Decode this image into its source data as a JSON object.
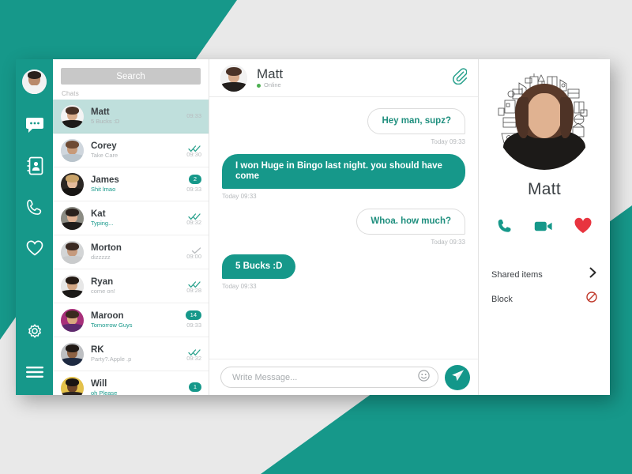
{
  "theme": {
    "accent": "#16988a",
    "accent_dark": "#13978a",
    "selected_row_bg": "#bfdfdc",
    "page_bg": "#e9e9e9",
    "heart_red": "#e8343f",
    "block_red": "#c0392b",
    "online_green": "#4caf50"
  },
  "rail": {
    "avatar_name": "user-avatar",
    "items": [
      {
        "icon": "chat-bubble-icon",
        "label": "Chats"
      },
      {
        "icon": "contacts-book-icon",
        "label": "Contacts"
      },
      {
        "icon": "phone-icon",
        "label": "Calls"
      },
      {
        "icon": "heart-icon",
        "label": "Favorites"
      }
    ],
    "bottom_items": [
      {
        "icon": "gear-icon",
        "label": "Settings"
      },
      {
        "icon": "hamburger-menu-icon",
        "label": "Menu"
      }
    ]
  },
  "sidebar": {
    "search": {
      "placeholder": "Search",
      "value": ""
    },
    "section_label": "Chats",
    "chats": [
      {
        "name": "Matt",
        "preview": "5 Bucks :D",
        "time": "09:33",
        "badge": "",
        "ticks": "none",
        "selected": true,
        "preview_accent": false,
        "avatar": "matt"
      },
      {
        "name": "Corey",
        "preview": "Take Care",
        "time": "09:30",
        "badge": "",
        "ticks": "double",
        "selected": false,
        "preview_accent": false,
        "avatar": "corey"
      },
      {
        "name": "James",
        "preview": "Shit lmao",
        "time": "09:33",
        "badge": "2",
        "ticks": "none",
        "selected": false,
        "preview_accent": true,
        "avatar": "james"
      },
      {
        "name": "Kat",
        "preview": "Typing...",
        "time": "09:32",
        "badge": "",
        "ticks": "double",
        "selected": false,
        "preview_accent": true,
        "avatar": "kat"
      },
      {
        "name": "Morton",
        "preview": "dizzzzz",
        "time": "09:00",
        "badge": "",
        "ticks": "single",
        "selected": false,
        "preview_accent": false,
        "avatar": "morton"
      },
      {
        "name": "Ryan",
        "preview": "come on!",
        "time": "09:28",
        "badge": "",
        "ticks": "double",
        "selected": false,
        "preview_accent": false,
        "avatar": "ryan"
      },
      {
        "name": "Maroon",
        "preview": "Tomorrow Guys",
        "time": "09:33",
        "badge": "14",
        "ticks": "none",
        "selected": false,
        "preview_accent": true,
        "avatar": "maroon"
      },
      {
        "name": "RK",
        "preview": "Party?.Apple .p",
        "time": "09:32",
        "badge": "",
        "ticks": "double",
        "selected": false,
        "preview_accent": false,
        "avatar": "rk"
      },
      {
        "name": "Will",
        "preview": "oh Please",
        "time": "",
        "badge": "1",
        "ticks": "none",
        "selected": false,
        "preview_accent": true,
        "avatar": "will"
      }
    ]
  },
  "conversation": {
    "title": "Matt",
    "status": "Online",
    "attach_icon": "paperclip-icon",
    "messages": [
      {
        "direction": "out",
        "text": "Hey man, supz?",
        "time": "Today 09:33"
      },
      {
        "direction": "in",
        "text": "I won Huge in Bingo last night. you should have come",
        "time": "Today 09:33"
      },
      {
        "direction": "out",
        "text": "Whoa. how much?",
        "time": "Today 09:33"
      },
      {
        "direction": "in",
        "text": "5 Bucks :D",
        "time": "Today 09:33"
      }
    ],
    "composer": {
      "placeholder": "Write Message...",
      "value": "",
      "emoji_icon": "smiley-face-icon",
      "send_icon": "send-paper-plane-icon"
    }
  },
  "profile": {
    "name": "Matt",
    "actions": [
      {
        "icon": "phone-icon",
        "label": "Call"
      },
      {
        "icon": "video-camera-icon",
        "label": "Video call"
      },
      {
        "icon": "heart-icon",
        "label": "Favorite"
      }
    ],
    "rows": [
      {
        "label": "Shared items",
        "icon": "chevron-right-icon"
      },
      {
        "label": "Block",
        "icon": "block-icon"
      }
    ]
  }
}
